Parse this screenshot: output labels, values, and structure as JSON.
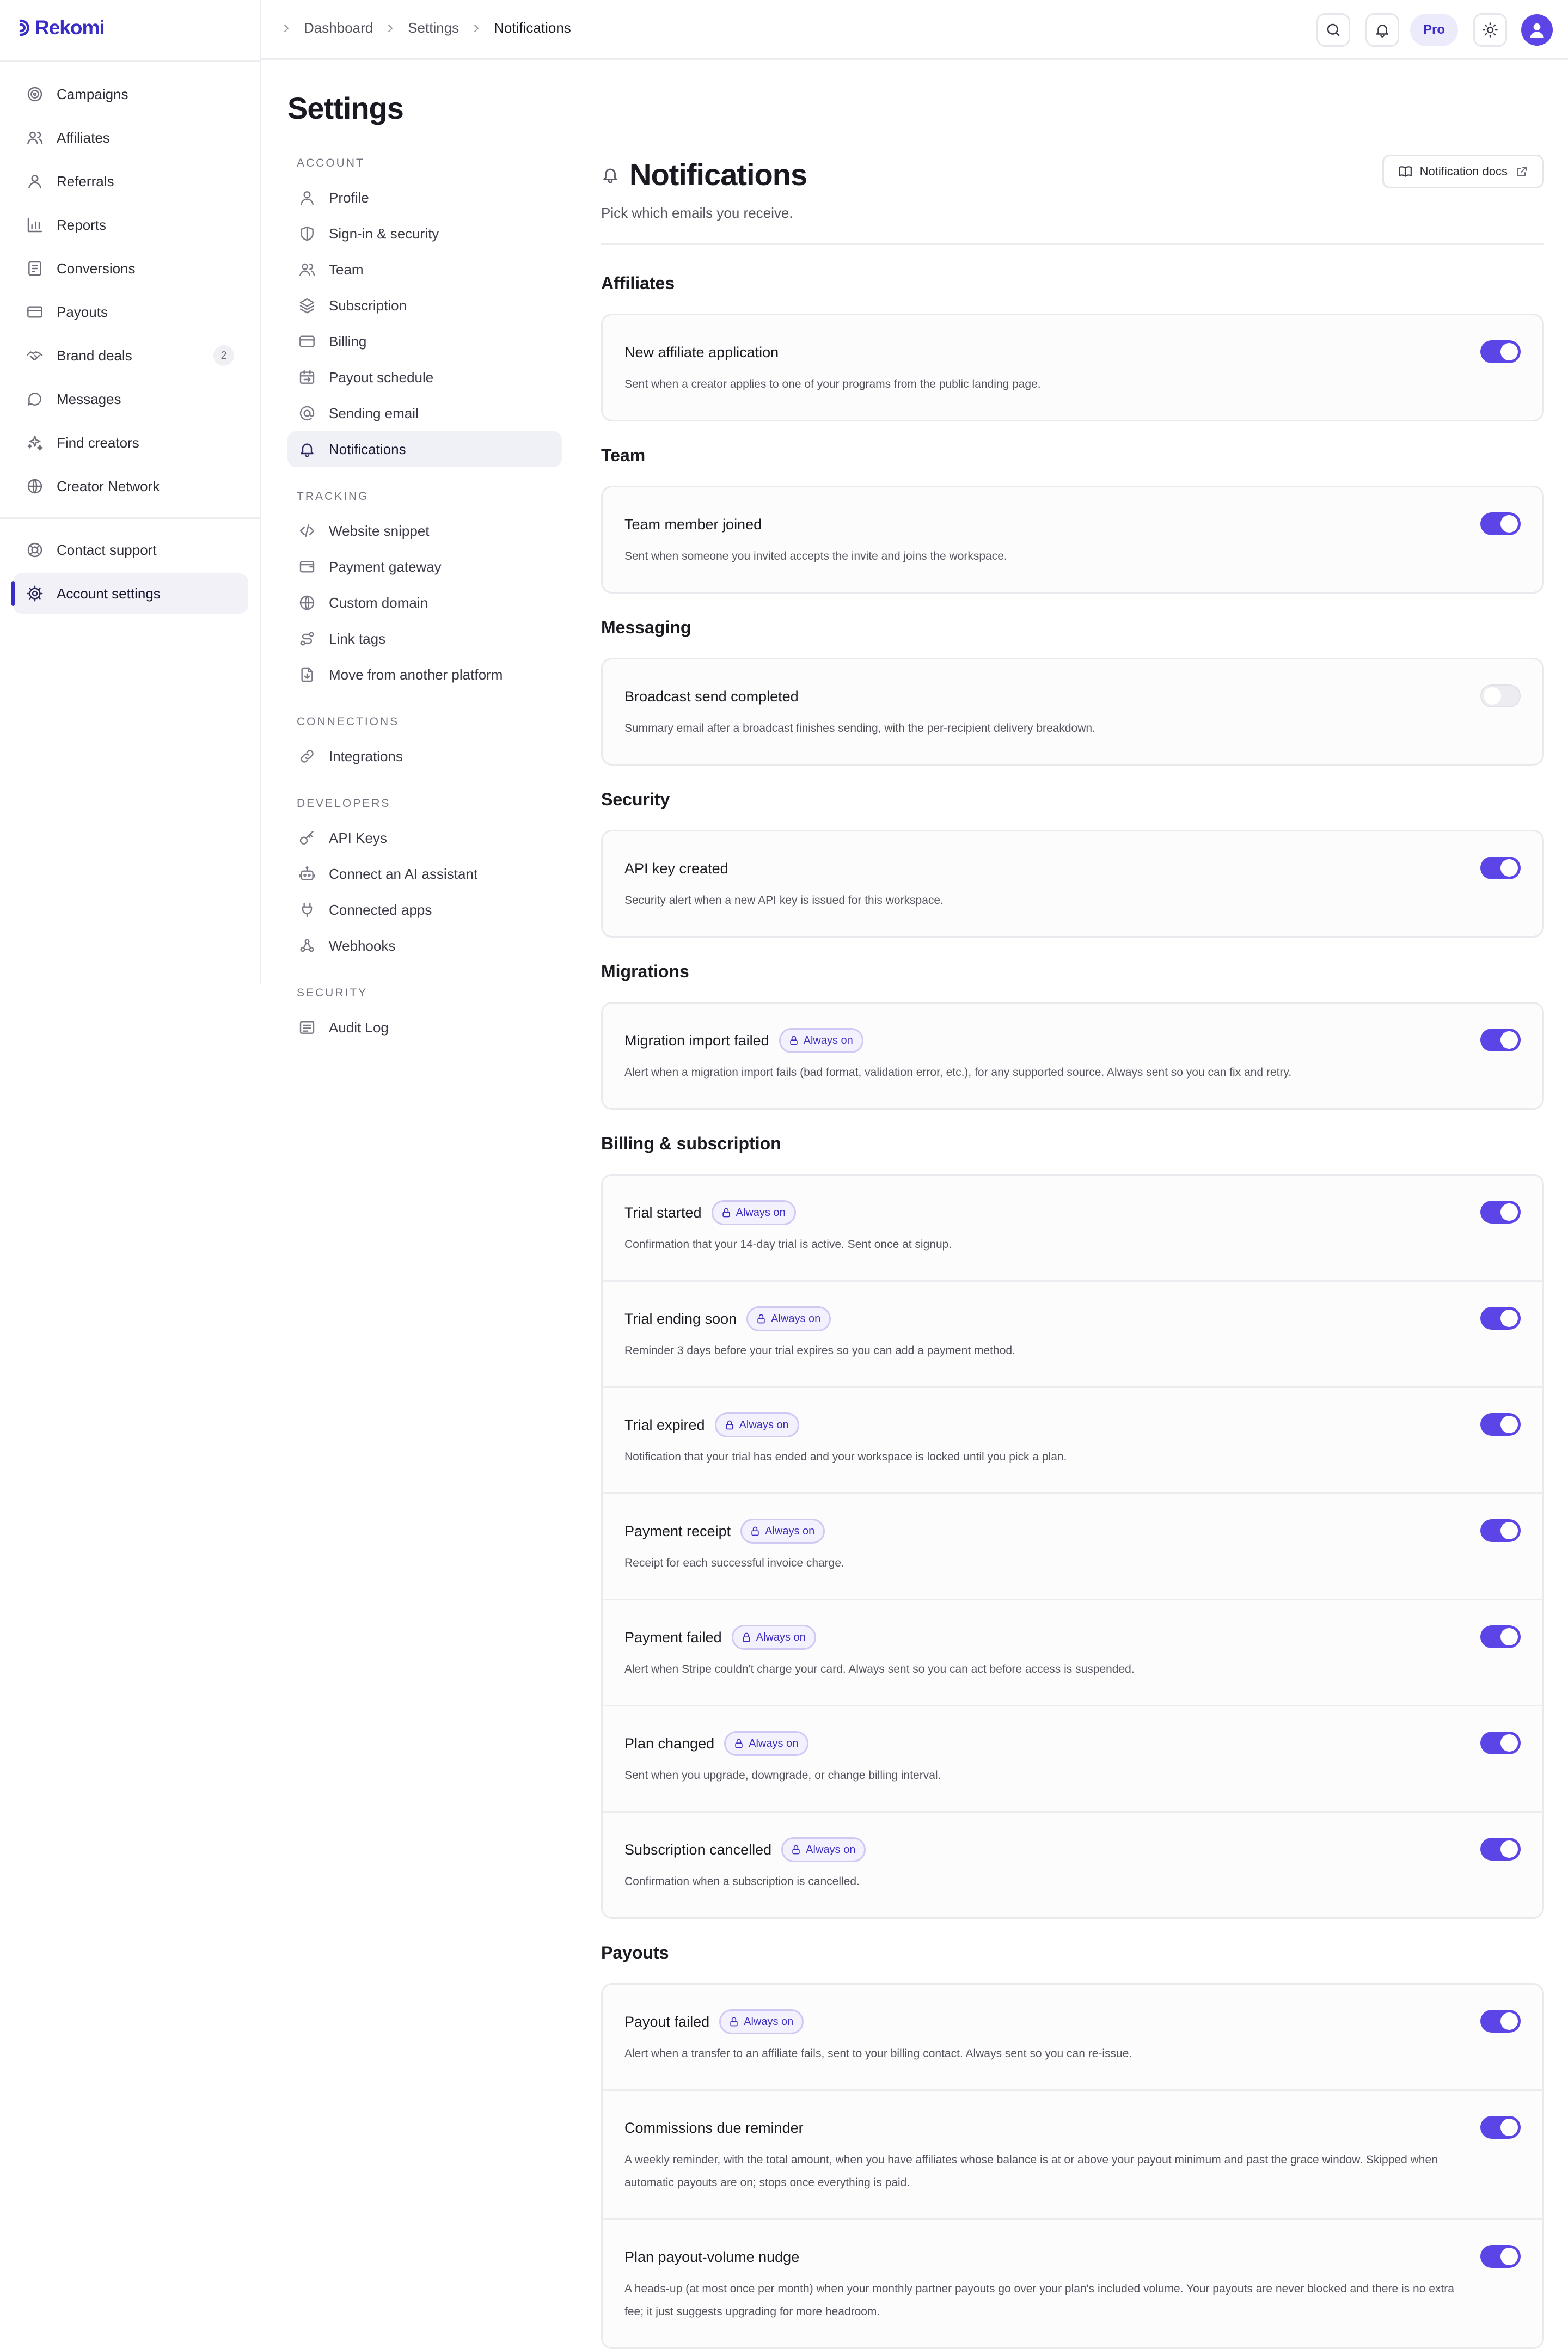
{
  "brand": {
    "name": "Rekomi",
    "color": "#3a2cc7"
  },
  "accent": "#5b45e6",
  "sidebar": {
    "items": [
      {
        "label": "Campaigns",
        "icon": "target-icon"
      },
      {
        "label": "Affiliates",
        "icon": "users-icon"
      },
      {
        "label": "Referrals",
        "icon": "user-icon"
      },
      {
        "label": "Reports",
        "icon": "bar-chart-icon"
      },
      {
        "label": "Conversions",
        "icon": "receipt-icon"
      },
      {
        "label": "Payouts",
        "icon": "credit-card-icon"
      },
      {
        "label": "Brand deals",
        "icon": "handshake-icon",
        "badge": "2"
      },
      {
        "label": "Messages",
        "icon": "message-icon"
      },
      {
        "label": "Find creators",
        "icon": "sparkles-icon"
      },
      {
        "label": "Creator Network",
        "icon": "globe-icon"
      }
    ],
    "footer": [
      {
        "label": "Contact support",
        "icon": "life-buoy-icon"
      },
      {
        "label": "Account settings",
        "icon": "gear-icon",
        "active": true
      }
    ]
  },
  "header": {
    "breadcrumbs": [
      "Dashboard",
      "Settings",
      "Notifications"
    ],
    "plan_badge": "Pro"
  },
  "settings": {
    "title": "Settings",
    "groups": [
      {
        "label": "ACCOUNT",
        "items": [
          "Profile",
          "Sign-in & security",
          "Team",
          "Subscription",
          "Billing",
          "Payout schedule",
          "Sending email",
          "Notifications"
        ]
      },
      {
        "label": "TRACKING",
        "items": [
          "Website snippet",
          "Payment gateway",
          "Custom domain",
          "Link tags",
          "Move from another platform"
        ]
      },
      {
        "label": "CONNECTIONS",
        "items": [
          "Integrations"
        ]
      },
      {
        "label": "DEVELOPERS",
        "items": [
          "API Keys",
          "Connect an AI assistant",
          "Connected apps",
          "Webhooks"
        ]
      },
      {
        "label": "SECURITY",
        "items": [
          "Audit Log"
        ]
      }
    ],
    "active_item": "Notifications"
  },
  "notifications": {
    "title": "Notifications",
    "subtitle": "Pick which emails you receive.",
    "docs_button": "Notification docs",
    "always_on_label": "Always on",
    "sections": [
      {
        "title": "Affiliates",
        "rows": [
          {
            "title": "New affiliate application",
            "desc": "Sent when a creator applies to one of your programs from the public landing page.",
            "enabled": true,
            "always_on": false
          }
        ]
      },
      {
        "title": "Team",
        "rows": [
          {
            "title": "Team member joined",
            "desc": "Sent when someone you invited accepts the invite and joins the workspace.",
            "enabled": true,
            "always_on": false
          }
        ]
      },
      {
        "title": "Messaging",
        "rows": [
          {
            "title": "Broadcast send completed",
            "desc": "Summary email after a broadcast finishes sending, with the per-recipient delivery breakdown.",
            "enabled": false,
            "always_on": false
          }
        ]
      },
      {
        "title": "Security",
        "rows": [
          {
            "title": "API key created",
            "desc": "Security alert when a new API key is issued for this workspace.",
            "enabled": true,
            "always_on": false
          }
        ]
      },
      {
        "title": "Migrations",
        "rows": [
          {
            "title": "Migration import failed",
            "desc": "Alert when a migration import fails (bad format, validation error, etc.), for any supported source. Always sent so you can fix and retry.",
            "enabled": true,
            "always_on": true
          }
        ]
      },
      {
        "title": "Billing & subscription",
        "rows": [
          {
            "title": "Trial started",
            "desc": "Confirmation that your 14-day trial is active. Sent once at signup.",
            "enabled": true,
            "always_on": true
          },
          {
            "title": "Trial ending soon",
            "desc": "Reminder 3 days before your trial expires so you can add a payment method.",
            "enabled": true,
            "always_on": true
          },
          {
            "title": "Trial expired",
            "desc": "Notification that your trial has ended and your workspace is locked until you pick a plan.",
            "enabled": true,
            "always_on": true
          },
          {
            "title": "Payment receipt",
            "desc": "Receipt for each successful invoice charge.",
            "enabled": true,
            "always_on": true
          },
          {
            "title": "Payment failed",
            "desc": "Alert when Stripe couldn't charge your card. Always sent so you can act before access is suspended.",
            "enabled": true,
            "always_on": true
          },
          {
            "title": "Plan changed",
            "desc": "Sent when you upgrade, downgrade, or change billing interval.",
            "enabled": true,
            "always_on": true
          },
          {
            "title": "Subscription cancelled",
            "desc": "Confirmation when a subscription is cancelled.",
            "enabled": true,
            "always_on": true
          }
        ]
      },
      {
        "title": "Payouts",
        "rows": [
          {
            "title": "Payout failed",
            "desc": "Alert when a transfer to an affiliate fails, sent to your billing contact. Always sent so you can re-issue.",
            "enabled": true,
            "always_on": true
          },
          {
            "title": "Commissions due reminder",
            "desc": "A weekly reminder, with the total amount, when you have affiliates whose balance is at or above your payout minimum and past the grace window. Skipped when automatic payouts are on; stops once everything is paid.",
            "enabled": true,
            "always_on": false
          },
          {
            "title": "Plan payout-volume nudge",
            "desc": "A heads-up (at most once per month) when your monthly partner payouts go over your plan's included volume. Your payouts are never blocked and there is no extra fee; it just suggests upgrading for more headroom.",
            "enabled": true,
            "always_on": false
          }
        ]
      }
    ]
  }
}
